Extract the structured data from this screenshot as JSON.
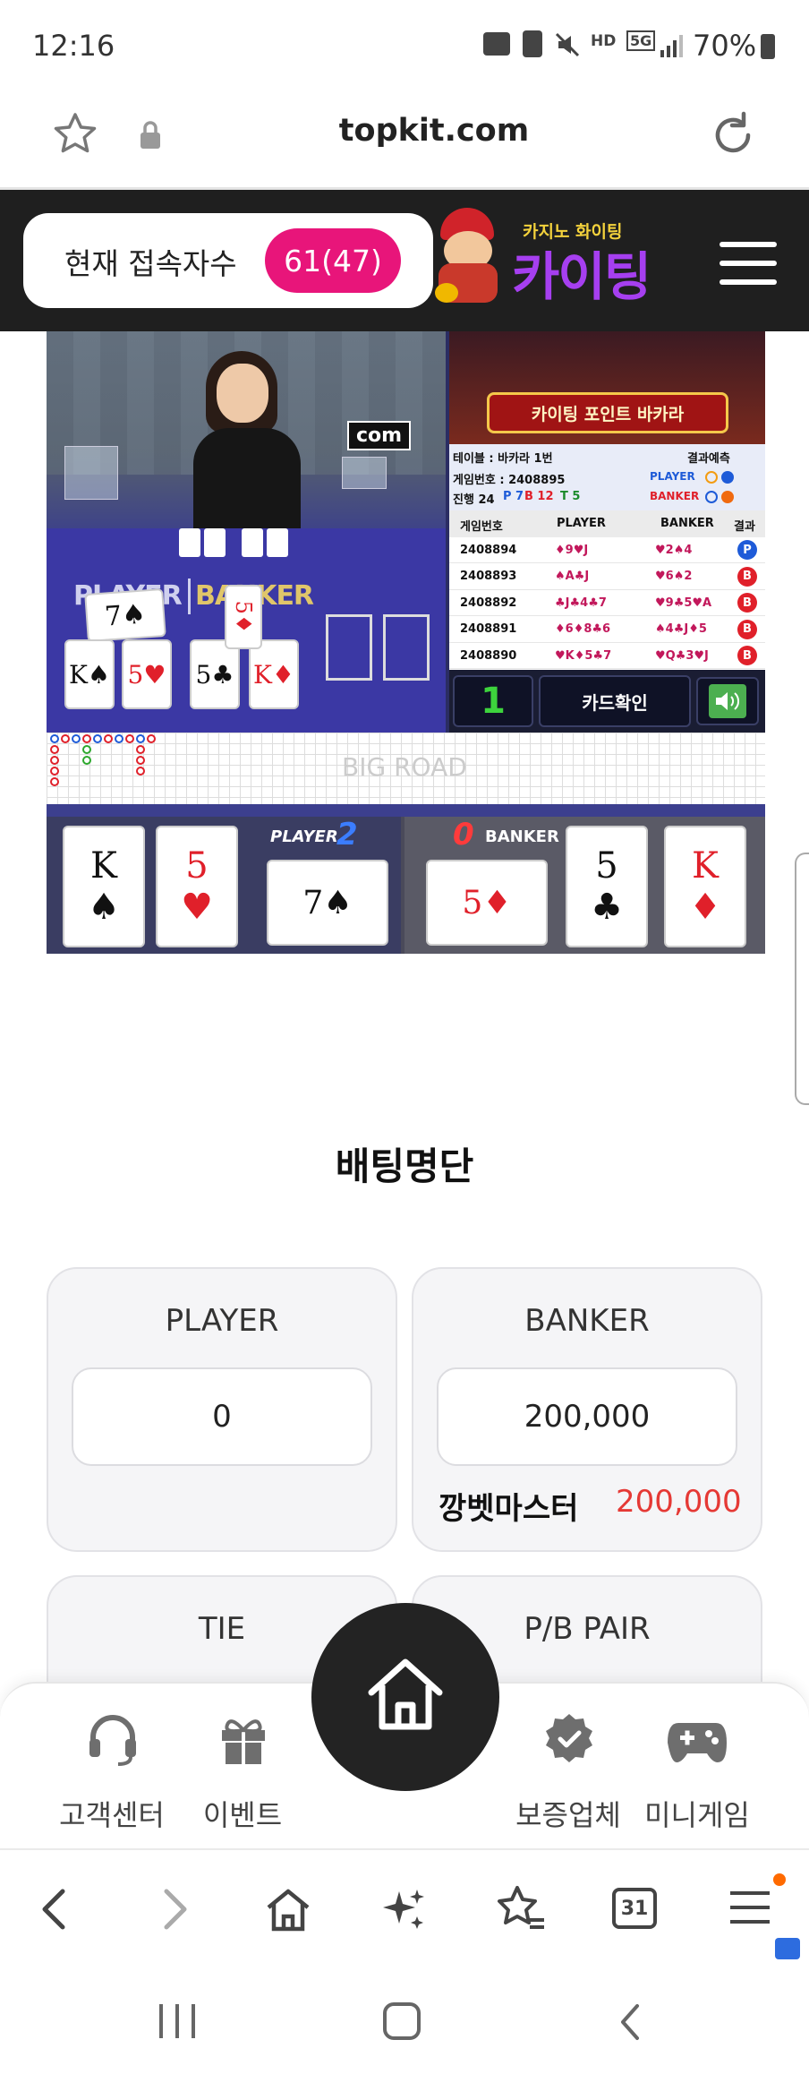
{
  "status_bar": {
    "time": "12:16",
    "network": "5G",
    "hd": "HD",
    "battery": "70%"
  },
  "browser": {
    "url": "topkit.com"
  },
  "site_header": {
    "visitors_label": "현재 접속자수",
    "visitors_count": "61(47)",
    "logo_small": "카지노 화이팅",
    "logo_main": "카이팅"
  },
  "game": {
    "overlay_text": "com",
    "table_player": "PLAYER",
    "table_banker": "BANKER",
    "banner_text": "카이팅 포인트 바카라",
    "info": {
      "table": "테이블 : 바카라 1번",
      "game_no": "게임번호 : 2408895",
      "progress": "진행 24",
      "p": "P 7",
      "b": "B 12",
      "t": "T 5",
      "prediction_title": "결과예측",
      "pred_player": "PLAYER",
      "pred_banker": "BANKER"
    },
    "history_headers": [
      "게임번호",
      "PLAYER",
      "BANKER",
      "결과"
    ],
    "history": [
      {
        "no": "2408894",
        "player": "♦9♥J",
        "banker": "♥2♠4",
        "result": "P"
      },
      {
        "no": "2408893",
        "player": "♠A♣J",
        "banker": "♥6♠2",
        "result": "B"
      },
      {
        "no": "2408892",
        "player": "♣J♣4♣7",
        "banker": "♥9♣5♥A",
        "result": "B"
      },
      {
        "no": "2408891",
        "player": "♦6♦8♣6",
        "banker": "♠4♣J♦5",
        "result": "B"
      },
      {
        "no": "2408890",
        "player": "♥K♦5♣7",
        "banker": "♥Q♣3♥J",
        "result": "B"
      }
    ],
    "round_number": "1",
    "card_check": "카드확인",
    "big_road": "BIG ROAD",
    "player_label": "PLAYER",
    "player_score": "2",
    "banker_label": "BANKER",
    "banker_score": "0",
    "player_cards": [
      {
        "rank": "K",
        "suit": "♠"
      },
      {
        "rank": "5",
        "suit": "♥"
      },
      {
        "rank": "7",
        "suit": "♠"
      }
    ],
    "banker_cards": [
      {
        "rank": "5",
        "suit": "♦"
      },
      {
        "rank": "5",
        "suit": "♣"
      },
      {
        "rank": "K",
        "suit": "♦"
      }
    ],
    "table_cards": {
      "player": [
        {
          "rank": "K",
          "suit": "♠"
        },
        {
          "rank": "5",
          "suit": "♥"
        },
        {
          "rank": "7",
          "suit": "♠"
        }
      ],
      "banker": [
        {
          "rank": "5",
          "suit": "♣"
        },
        {
          "rank": "K",
          "suit": "♦"
        },
        {
          "rank": "5",
          "suit": "♦"
        }
      ]
    }
  },
  "betting": {
    "title": "배팅명단",
    "player": {
      "label": "PLAYER",
      "value": "0"
    },
    "banker": {
      "label": "BANKER",
      "value": "200,000",
      "bettor": "깡벳마스터",
      "bettor_amount": "200,000"
    },
    "tie": {
      "label": "TIE"
    },
    "pair": {
      "label": "P/B PAIR"
    }
  },
  "bottom_nav": {
    "support": "고객센터",
    "event": "이벤트",
    "verified": "보증업체",
    "minigame": "미니게임"
  },
  "browser_nav": {
    "tabs_count": "31"
  },
  "colors": {
    "accent_pink": "#e8157a",
    "header_dark": "#1f1f1f",
    "bettor_red": "#e53935",
    "player_blue": "#1e5bd8",
    "banker_red": "#e0202a"
  }
}
